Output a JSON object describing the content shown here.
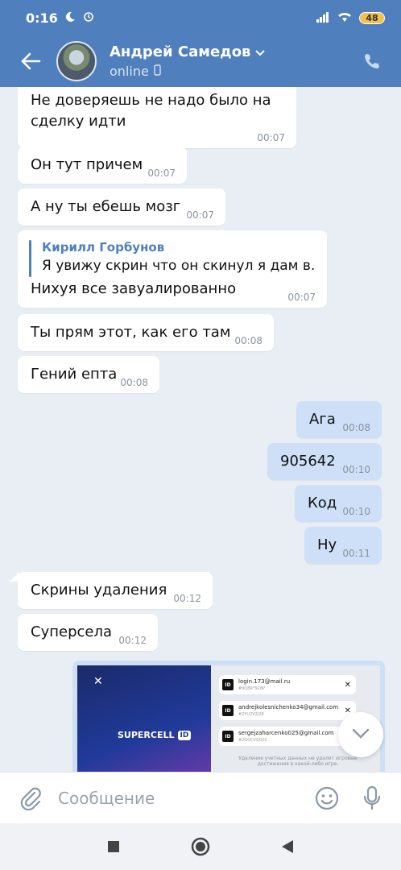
{
  "status_bar": {
    "time": "0:16",
    "battery": "48"
  },
  "header": {
    "contact_name": "Андрей Самедов",
    "status": "online"
  },
  "messages": [
    {
      "dir": "in",
      "text": "Не доверяешь не надо было на сделку идти",
      "time": "00:07"
    },
    {
      "dir": "in",
      "text": "Он тут причем",
      "time": "00:07"
    },
    {
      "dir": "in",
      "text": "А ну ты ебешь мозг",
      "time": "00:07"
    },
    {
      "dir": "in",
      "reply_author": "Кирилл Горбунов",
      "reply_text": "Я увижу скрин что он скинул я дам в...",
      "text": "Нихуя все завуалированно",
      "time": "00:07"
    },
    {
      "dir": "in",
      "text": "Ты прям этот, как его там",
      "time": "00:08"
    },
    {
      "dir": "in",
      "text": "Гений епта",
      "time": "00:08"
    },
    {
      "dir": "out",
      "text": "Ага",
      "time": "00:08"
    },
    {
      "dir": "out",
      "text": "905642",
      "time": "00:10"
    },
    {
      "dir": "out",
      "text": "Код",
      "time": "00:10"
    },
    {
      "dir": "out",
      "text": "Ну",
      "time": "00:11"
    },
    {
      "dir": "in",
      "text": "Скрины удаления",
      "time": "00:12"
    },
    {
      "dir": "in",
      "text": "Суперсела",
      "time": "00:12"
    }
  ],
  "image_preview": {
    "logo_text": "SUPERCELL",
    "logo_badge": "ID",
    "close_glyph": "✕",
    "accounts": [
      {
        "email": "login.173@mail.ru",
        "code": "#9Q8R*928P"
      },
      {
        "email": "andrejkolesnichenko34@gmail.com",
        "code": "#2YU2V2J28"
      },
      {
        "email": "sergejzaharcenko025@gmail.com",
        "code": "#2GOCVG020"
      }
    ],
    "caption": "Удаление учетных данных не удалит игровые достижения в какой-либо игре."
  },
  "composer": {
    "placeholder": "Сообщение"
  },
  "colors": {
    "header": "#4f7fbd",
    "incoming": "#ffffff",
    "outgoing": "#cde0f7",
    "background": "#e9eef4"
  },
  "icons": {
    "back": "arrow-left-icon",
    "call": "phone-icon",
    "attach": "paperclip-icon",
    "emoji": "smiley-icon",
    "mic": "microphone-icon",
    "scroll": "chevron-down-icon",
    "nav_recent": "square-icon",
    "nav_home": "circle-icon",
    "nav_back": "triangle-icon"
  }
}
